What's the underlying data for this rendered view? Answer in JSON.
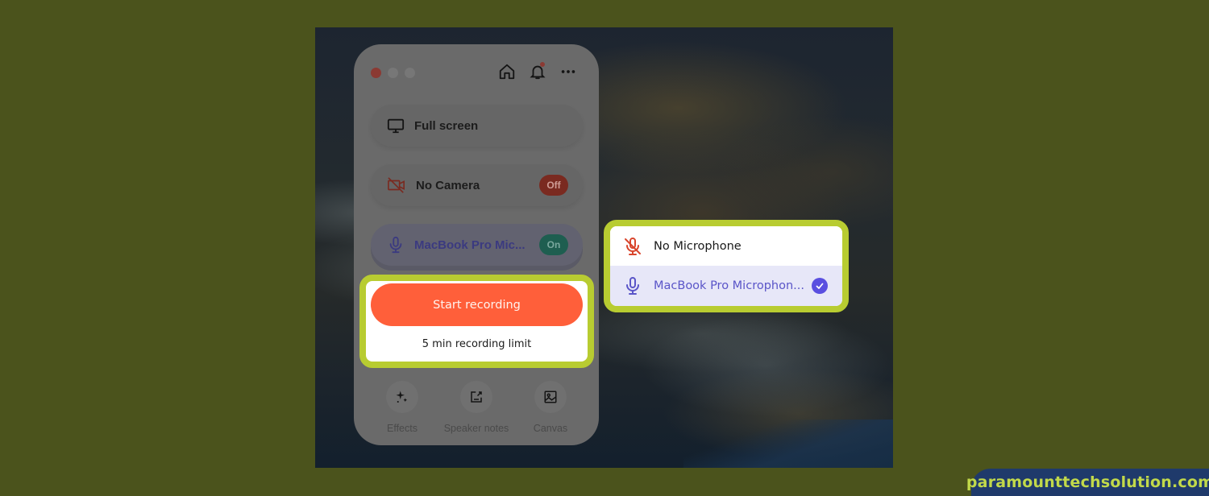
{
  "background": {
    "frame_color": "#4b531c",
    "highlight_color": "#b8cc31"
  },
  "panel": {
    "window_controls": [
      "close",
      "minimize",
      "maximize"
    ],
    "toolbar_icons": [
      "home-icon",
      "bell-icon",
      "more-icon"
    ],
    "notification_badge": true,
    "rows": [
      {
        "icon": "monitor-icon",
        "label": "Full screen"
      },
      {
        "icon": "camera-off-icon",
        "label": "No Camera",
        "toggle": "Off"
      },
      {
        "icon": "microphone-icon",
        "label": "MacBook Pro Mic...",
        "toggle": "On"
      }
    ],
    "record": {
      "button_label": "Start recording",
      "limit_text": "5 min recording limit",
      "accent": "#ff5f3a"
    },
    "tools": [
      {
        "icon": "effects-sparkle-icon",
        "label": "Effects"
      },
      {
        "icon": "speaker-notes-icon",
        "label": "Speaker notes"
      },
      {
        "icon": "canvas-image-icon",
        "label": "Canvas"
      }
    ]
  },
  "mic_dropdown": {
    "options": [
      {
        "icon": "microphone-off-icon",
        "label": "No Microphone",
        "selected": false
      },
      {
        "icon": "microphone-icon",
        "label": "MacBook Pro Microphon...",
        "selected": true
      }
    ],
    "selected_color": "#5a4fe0"
  },
  "watermark": {
    "text": "paramounttechsolution.com"
  }
}
